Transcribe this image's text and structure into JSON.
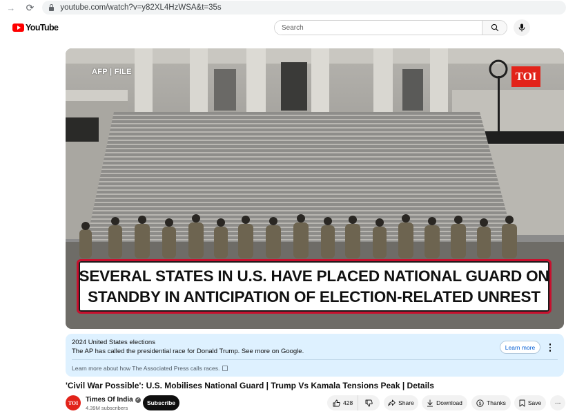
{
  "browser": {
    "url": "youtube.com/watch?v=y82XL4HzWSA&t=35s"
  },
  "header": {
    "logo_text": "YouTube",
    "search_placeholder": "Search"
  },
  "video": {
    "watermark_left": "AFP | FILE",
    "watermark_right": "TOI",
    "caption": "SEVERAL STATES IN U.S. HAVE PLACED NATIONAL GUARD ON STANDBY IN ANTICIPATION OF ELECTION-RELATED UNREST"
  },
  "info_panel": {
    "title": "2024 United States elections",
    "body": "The AP has called the presidential race for Donald Trump. See more on Google.",
    "footer": "Learn more about how The Associated Press calls races.",
    "learn_more_label": "Learn more"
  },
  "details": {
    "title": "'Civil War Possible': U.S. Mobilises National Guard | Trump Vs Kamala Tensions Peak | Details",
    "channel_avatar_text": "TOI",
    "channel_name": "Times Of India",
    "subscribers": "4.39M subscribers",
    "subscribe_label": "Subscribe"
  },
  "actions": {
    "like_count": "428",
    "share_label": "Share",
    "download_label": "Download",
    "thanks_label": "Thanks",
    "save_label": "Save",
    "more_label": "···"
  },
  "colors": {
    "youtube_red": "#ff0000",
    "toi_red": "#e2231a",
    "info_bg": "#def1ff",
    "link_blue": "#065fd4"
  }
}
